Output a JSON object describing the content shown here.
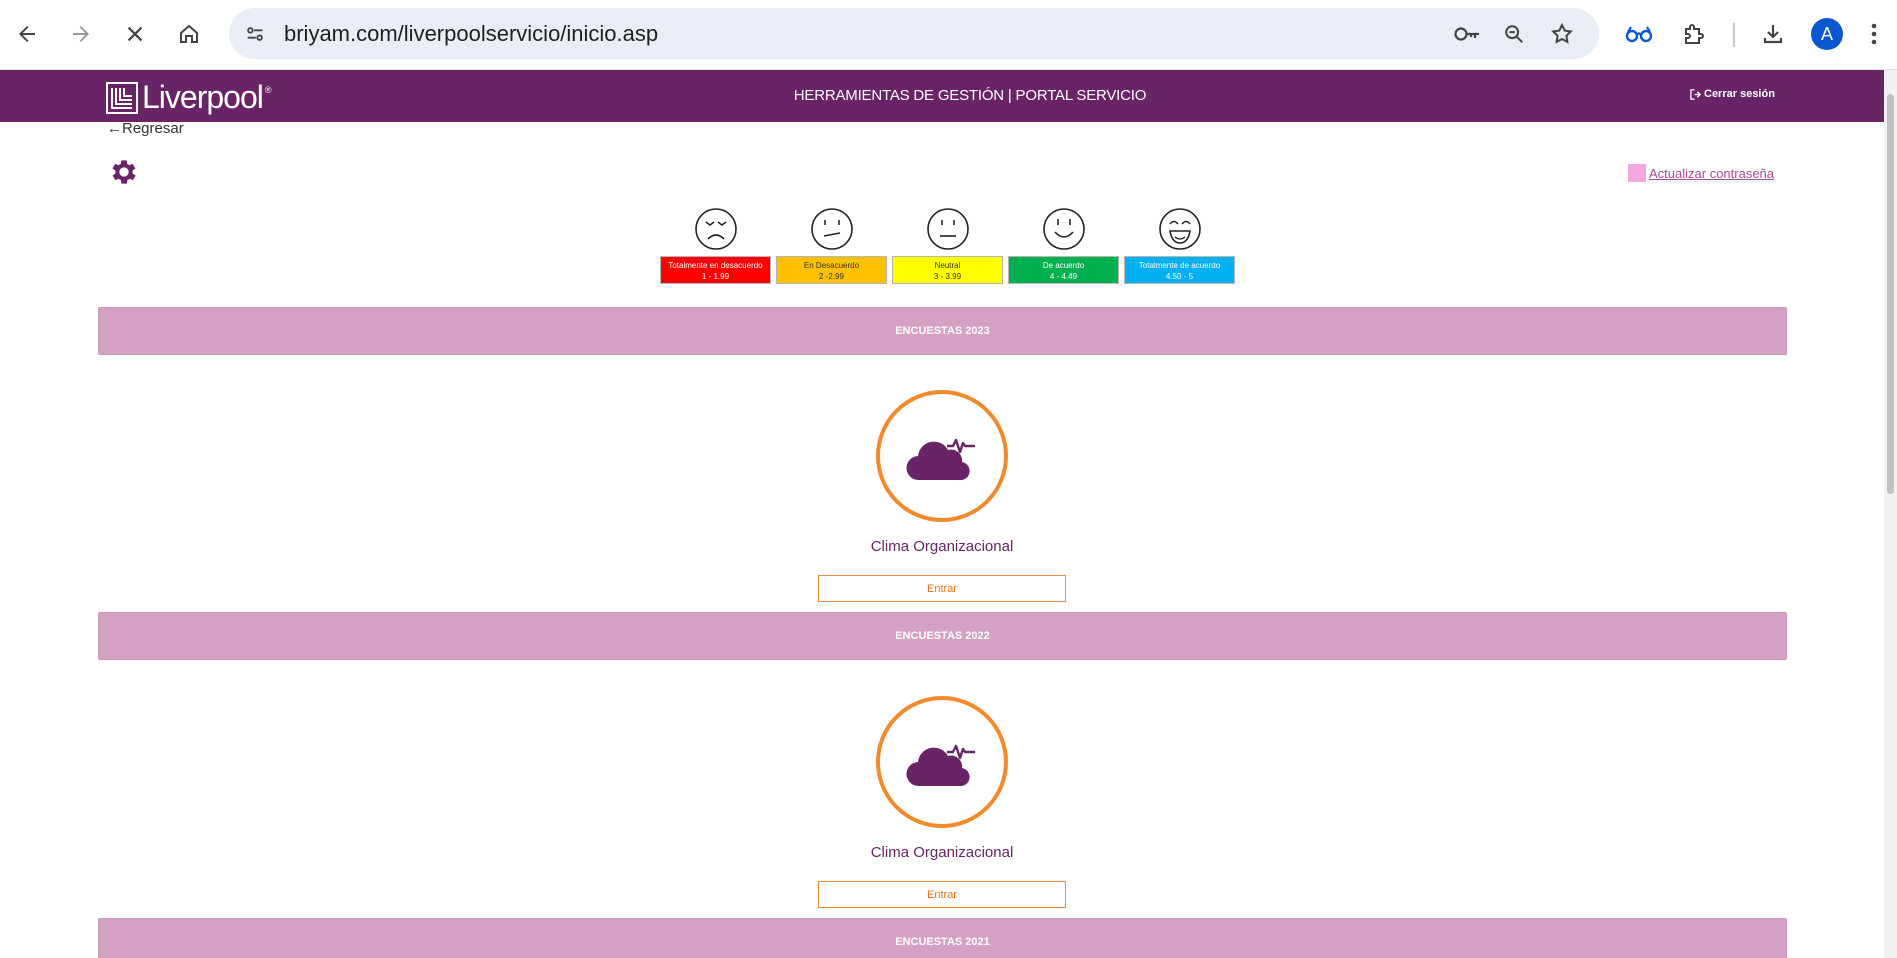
{
  "browser": {
    "url": "briyam.com/liverpoolservicio/inicio.asp",
    "profile_initial": "A",
    "icons": [
      "back-icon",
      "forward-icon",
      "stop-icon",
      "home-icon",
      "site-info-icon",
      "password-key-icon",
      "zoom-icon",
      "bookmark-star-icon",
      "reading-glasses-icon",
      "extensions-icon",
      "downloads-icon",
      "menu-icon"
    ]
  },
  "header": {
    "logo_text": "Liverpool",
    "logo_reg": "®",
    "title": "HERRAMIENTAS DE GESTIÓN | PORTAL SERVICIO",
    "logout_label": "Cerrar sesión",
    "bg_color": "#682466"
  },
  "page": {
    "back_label": "Regresar",
    "password_link": "Actualizar contraseña"
  },
  "scale": [
    {
      "label": "Totalmente en desacuerdo",
      "range": "1 - 1.99",
      "color": "#ff0000",
      "text_color": "#ffffff",
      "face": "very-sad"
    },
    {
      "label": "En Desacuerdo",
      "range": "2 -2.99",
      "color": "#ffc000",
      "text_color": "#333333",
      "face": "sad"
    },
    {
      "label": "Neutral",
      "range": "3 - 3.99",
      "color": "#ffff00",
      "text_color": "#333333",
      "face": "neutral"
    },
    {
      "label": "De acuerdo",
      "range": "4 - 4.49",
      "color": "#00b050",
      "text_color": "#ffffff",
      "face": "happy"
    },
    {
      "label": "Totalmente de acuerdo",
      "range": "4.50 - 5",
      "color": "#00b0f0",
      "text_color": "#ffffff",
      "face": "very-happy"
    }
  ],
  "sections": [
    {
      "title": "ENCUESTAS 2023",
      "survey_name": "Clima Organizacional",
      "button": "Entrar"
    },
    {
      "title": "ENCUESTAS 2022",
      "survey_name": "Clima Organizacional",
      "button": "Entrar"
    },
    {
      "title": "ENCUESTAS 2021"
    }
  ]
}
